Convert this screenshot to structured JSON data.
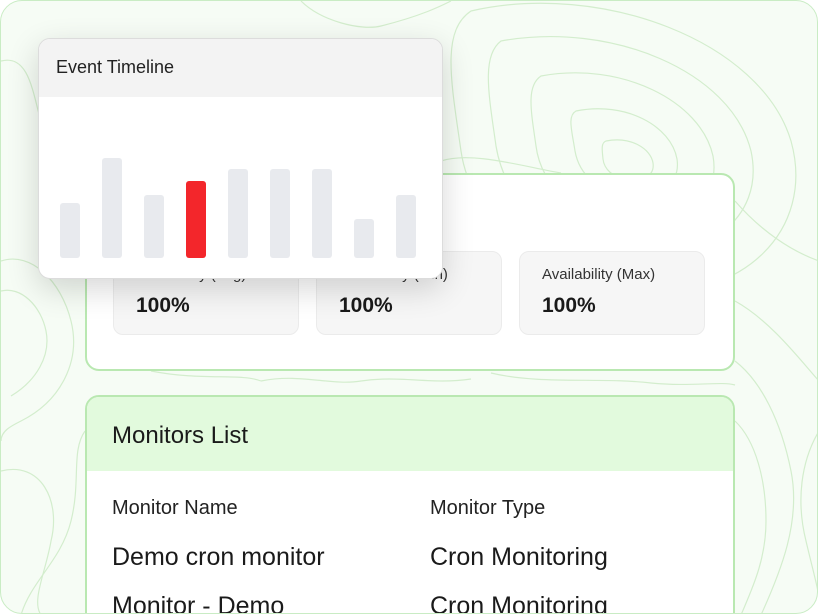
{
  "availability": {
    "stats": [
      {
        "label": "Availability (Avg)",
        "value": "100%"
      },
      {
        "label": "Availability (Min)",
        "value": "100%"
      },
      {
        "label": "Availability (Max)",
        "value": "100%"
      }
    ]
  },
  "monitors": {
    "title": "Monitors List",
    "columns": [
      "Monitor Name",
      "Monitor Type"
    ],
    "rows": [
      [
        "Demo cron monitor",
        "Cron Monitoring"
      ],
      [
        "Monitor - Demo",
        "Cron Monitoring"
      ]
    ]
  },
  "timeline": {
    "title": "Event Timeline",
    "bar_levels": [
      0.55,
      1.0,
      0.63,
      0.77,
      0.89,
      0.89,
      0.89,
      0.39,
      0.63
    ],
    "highlighted_index": 3,
    "bar_color": "#e8eaee",
    "highlight_color": "#f3262b"
  },
  "colors": {
    "accent_border": "#b9e8b1",
    "header_green": "#e2fadd",
    "background": "#f6fcf5"
  }
}
